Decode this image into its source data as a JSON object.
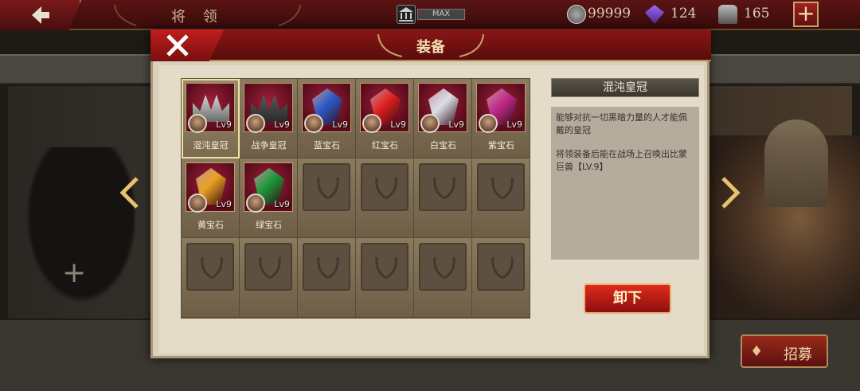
{
  "topbar": {
    "title": "将 领",
    "max_label": "MAX",
    "coins": "99999",
    "gems": "124",
    "helmets": "165",
    "plus_label": "+"
  },
  "background": {
    "empty_slot_plus": "+",
    "recruit_label": "招募"
  },
  "modal": {
    "title": "装备",
    "items": [
      {
        "name": "混沌皇冠",
        "level": "Lv9",
        "kind": "crown",
        "color": "#d0d0d0",
        "selected": true
      },
      {
        "name": "战争皇冠",
        "level": "Lv9",
        "kind": "crown2",
        "color": "#2a2a2a"
      },
      {
        "name": "蓝宝石",
        "level": "Lv9",
        "kind": "gem",
        "color": "#2a5ac8"
      },
      {
        "name": "红宝石",
        "level": "Lv9",
        "kind": "gem",
        "color": "#e02020"
      },
      {
        "name": "白宝石",
        "level": "Lv9",
        "kind": "gem",
        "color": "#d8e0e8"
      },
      {
        "name": "紫宝石",
        "level": "Lv9",
        "kind": "gem",
        "color": "#c02a8a"
      },
      {
        "name": "黄宝石",
        "level": "Lv9",
        "kind": "gem",
        "color": "#e8a020"
      },
      {
        "name": "绿宝石",
        "level": "Lv9",
        "kind": "gem",
        "color": "#1a9a3a"
      }
    ],
    "detail": {
      "title": "混沌皇冠",
      "description": "能够对抗一切黑暗力量的人才能佩戴的皇冠",
      "effect": "将领装备后能在战场上召唤出比蒙巨兽【LV.9】"
    },
    "unequip_label": "卸下"
  }
}
